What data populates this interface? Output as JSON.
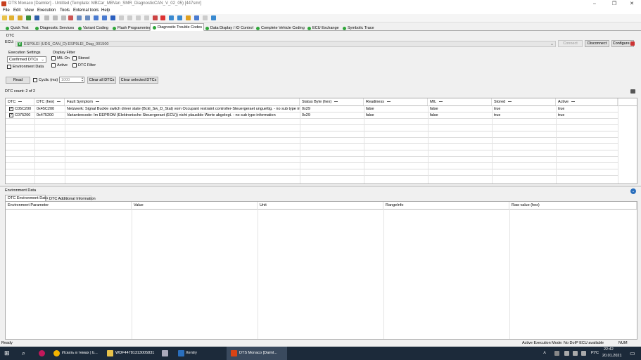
{
  "window": {
    "title": "DTS Monaco [Daimler] - Untitled (Template: MBCar_MBVan_SMR_DiagnosticCAN_V_02_05) [447smr]",
    "controls": [
      "–",
      "❐",
      "✕"
    ]
  },
  "menu": [
    "File",
    "Edit",
    "View",
    "Execution",
    "Tools",
    "External tools",
    "Help"
  ],
  "tabs": [
    "Quick Test",
    "Diagnostic Services",
    "Variant Coding",
    "Flash Programming",
    "Diagnostic Trouble Codes",
    "Data Display / IO Control",
    "Complete Vehicle Coding",
    "ECU Exchange",
    "Symbolic Trace"
  ],
  "dtc_section": {
    "label": "DTC",
    "ecu_label": "ECU:",
    "ecu_value": "ESP9LEI (UDS_CAN_D) ESP9LEI_Diag_001500",
    "ecu_badge": "V",
    "connect": "Connect",
    "disconnect": "Disconnect",
    "configure": "Configure...",
    "execution_settings": "Execution Settings",
    "execution_mode": "Confirmed DTCs",
    "environment_data": "Environment Data",
    "display_filter": "Display Filter",
    "filters": {
      "mil_on": "MIL On",
      "stored": "Stored",
      "active": "Active",
      "dtc_filter": "DTC Filter"
    },
    "read": "Read",
    "cyclic": "Cyclic (ms)",
    "cyclic_value": "1000",
    "clear_all": "Clear all DTCs",
    "clear_selected": "Clear selected DTCs",
    "count": "DTC count:   2 of 2"
  },
  "dtc_table": {
    "headers": [
      "DTC",
      "DTC (hex)",
      "Fault Symptom",
      "Status Byte (hex)",
      "Readiness",
      "MIL",
      "Stored",
      "Active"
    ],
    "rows": [
      {
        "checked": "✓",
        "dtc": "C05C200",
        "hex": "0x45C200",
        "symptom": "Netzwerk: Signal Buckle switch driver state (Bckl_Sw_D_Stat) vom Occupant restraint controller-Steuergeraet ungueltig. - no sub type information",
        "status": "0x29",
        "readiness": "false",
        "mil": "false",
        "stored": "true",
        "active": "true"
      },
      {
        "checked": "✓",
        "dtc": "C075200",
        "hex": "0x475200",
        "symptom": "Variantencode: Im EEPROM (Elektronische Steuergeraet (ECU)) nicht plausible Werte abgelegt. - no sub type information",
        "status": "0x29",
        "readiness": "false",
        "mil": "false",
        "stored": "true",
        "active": "true"
      }
    ]
  },
  "env_section": {
    "label": "Environment Data",
    "tabs": [
      "DTC Environment Data",
      "DTC Additional Information"
    ],
    "headers": [
      "Environment Parameter",
      "Value",
      "Unit",
      "RangeInfo",
      "Raw value (hex)"
    ]
  },
  "status": {
    "left": "Ready",
    "mode": "Active Execution Mode:  No DoIP ECU available",
    "num": "NUM"
  },
  "taskbar": {
    "items": [
      "Искать в темах | b...",
      "WDF44781313005831",
      "Xentry",
      "DTS Monaco [Daiml..."
    ],
    "lang": "РУС",
    "time": "22:42",
    "date": "20.01.2021"
  }
}
